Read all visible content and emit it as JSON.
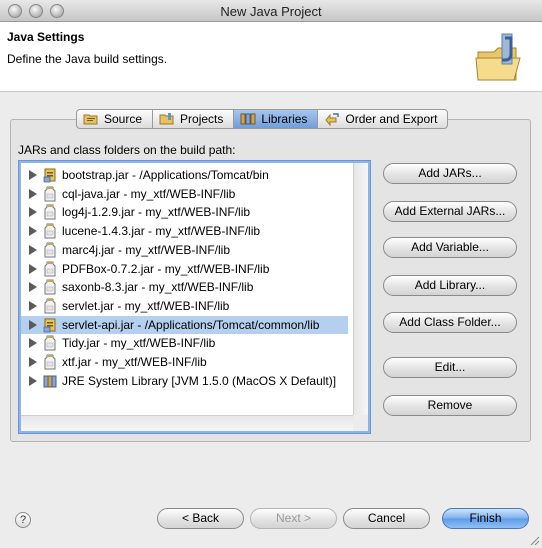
{
  "window": {
    "title": "New Java Project"
  },
  "banner": {
    "title": "Java Settings",
    "description": "Define the Java build settings."
  },
  "tabs": [
    {
      "label": "Source",
      "icon": "source-folder-icon",
      "active": false
    },
    {
      "label": "Projects",
      "icon": "projects-icon",
      "active": false
    },
    {
      "label": "Libraries",
      "icon": "libraries-icon",
      "active": true
    },
    {
      "label": "Order and Export",
      "icon": "order-export-icon",
      "active": false
    }
  ],
  "build_path": {
    "label": "JARs and class folders on the build path:",
    "entries": [
      {
        "label": "bootstrap.jar - /Applications/Tomcat/bin",
        "icon": "external-jar-icon",
        "selected": false
      },
      {
        "label": "cql-java.jar - my_xtf/WEB-INF/lib",
        "icon": "jar-icon",
        "selected": false
      },
      {
        "label": "log4j-1.2.9.jar - my_xtf/WEB-INF/lib",
        "icon": "jar-icon",
        "selected": false
      },
      {
        "label": "lucene-1.4.3.jar - my_xtf/WEB-INF/lib",
        "icon": "jar-icon",
        "selected": false
      },
      {
        "label": "marc4j.jar - my_xtf/WEB-INF/lib",
        "icon": "jar-icon",
        "selected": false
      },
      {
        "label": "PDFBox-0.7.2.jar - my_xtf/WEB-INF/lib",
        "icon": "jar-icon",
        "selected": false
      },
      {
        "label": "saxonb-8.3.jar - my_xtf/WEB-INF/lib",
        "icon": "jar-icon",
        "selected": false
      },
      {
        "label": "servlet.jar - my_xtf/WEB-INF/lib",
        "icon": "jar-icon",
        "selected": false
      },
      {
        "label": "servlet-api.jar - /Applications/Tomcat/common/lib",
        "icon": "external-jar-icon",
        "selected": true
      },
      {
        "label": "Tidy.jar - my_xtf/WEB-INF/lib",
        "icon": "jar-icon",
        "selected": false
      },
      {
        "label": "xtf.jar - my_xtf/WEB-INF/lib",
        "icon": "jar-icon",
        "selected": false
      },
      {
        "label": "JRE System Library [JVM 1.5.0 (MacOS X Default)]",
        "icon": "jre-library-icon",
        "selected": false
      }
    ]
  },
  "side_buttons": {
    "add_jars": "Add JARs...",
    "add_external_jars": "Add External JARs...",
    "add_variable": "Add Variable...",
    "add_library": "Add Library...",
    "add_class_folder": "Add Class Folder...",
    "edit": "Edit...",
    "remove": "Remove"
  },
  "footer": {
    "help": "?",
    "back": "< Back",
    "next": "Next >",
    "cancel": "Cancel",
    "finish": "Finish"
  },
  "colors": {
    "selection": "#b5d0ef",
    "default_button": "#5c9ce8",
    "focus_ring": "#8fb3e6"
  }
}
